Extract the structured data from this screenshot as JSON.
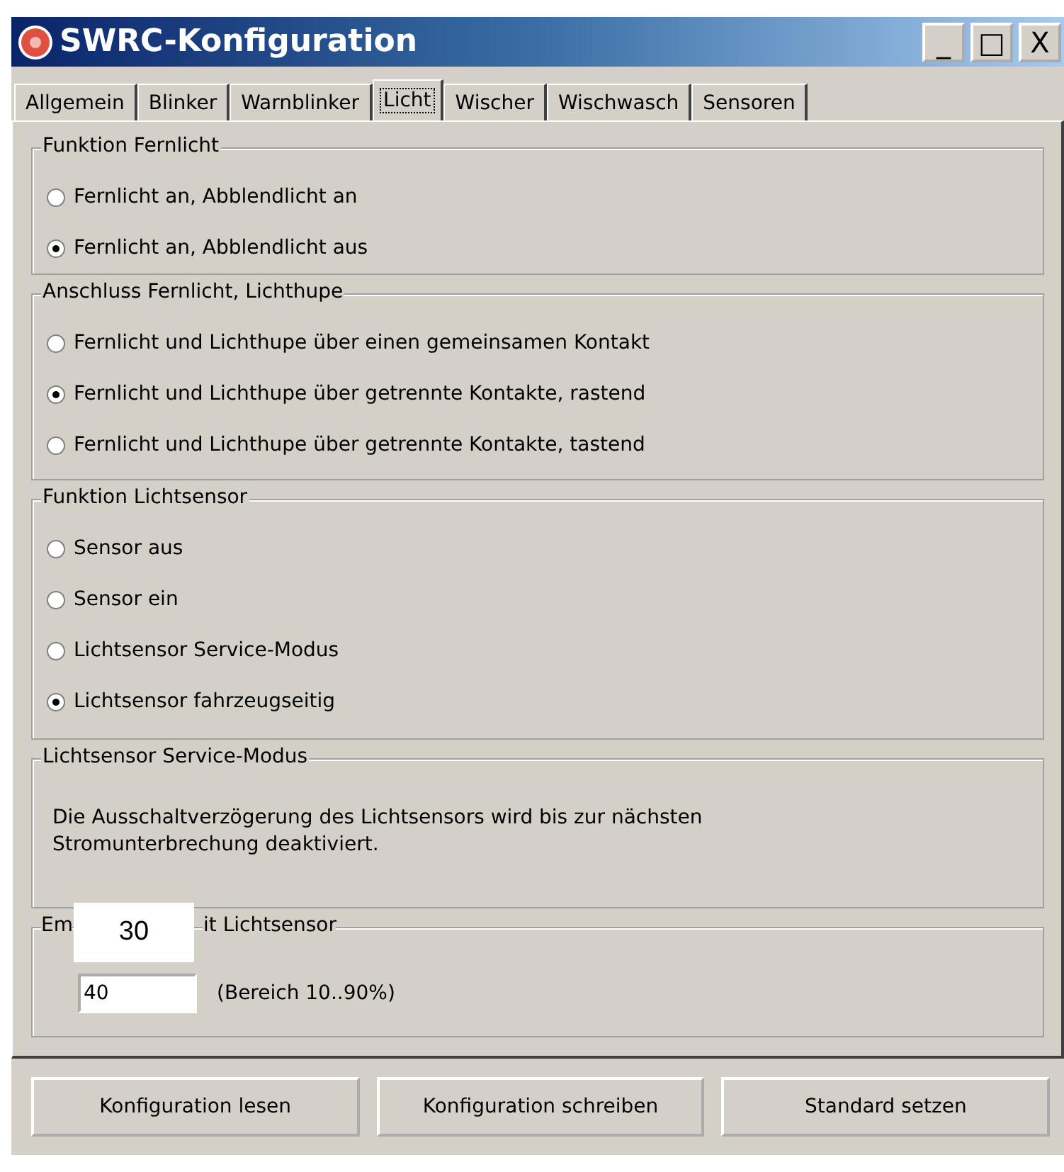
{
  "window": {
    "title": "SWRC-Konfiguration",
    "controls": [
      "_",
      "□",
      "X"
    ]
  },
  "tabs": [
    {
      "label": "Allgemein",
      "selected": false
    },
    {
      "label": "Blinker",
      "selected": false
    },
    {
      "label": "Warnblinker",
      "selected": false
    },
    {
      "label": "Licht",
      "selected": true
    },
    {
      "label": "Wischer",
      "selected": false
    },
    {
      "label": "Wischwasch",
      "selected": false
    },
    {
      "label": "Sensoren",
      "selected": false
    }
  ],
  "groups": [
    {
      "kind": "radios",
      "title": "Funktion Fernlicht",
      "options": [
        {
          "label": "Fernlicht an, Abblendlicht an",
          "selected": false
        },
        {
          "label": "Fernlicht an, Abblendlicht aus",
          "selected": true
        }
      ]
    },
    {
      "kind": "radios",
      "title": "Anschluss Fernlicht, Lichthupe",
      "options": [
        {
          "label": "Fernlicht und Lichthupe über einen gemeinsamen Kontakt",
          "selected": false
        },
        {
          "label": "Fernlicht und Lichthupe über getrennte Kontakte, rastend",
          "selected": true
        },
        {
          "label": "Fernlicht und Lichthupe über getrennte Kontakte, tastend",
          "selected": false
        }
      ]
    },
    {
      "kind": "radios",
      "title": "Funktion Lichtsensor",
      "options": [
        {
          "label": "Sensor aus",
          "selected": false
        },
        {
          "label": "Sensor ein",
          "selected": false
        },
        {
          "label": "Lichtsensor Service-Modus",
          "selected": false
        },
        {
          "label": "Lichtsensor fahrzeugseitig",
          "selected": true
        }
      ]
    },
    {
      "kind": "text",
      "title": "Lichtsensor Service-Modus",
      "text": "Die Ausschaltverzögerung des Lichtsensors wird bis zur nächsten Stromunterbrechung deaktiviert."
    },
    {
      "kind": "input",
      "title_start": "Em",
      "title_end": "it Lichtsensor",
      "value": "40",
      "hint": "(Bereich 10..90%)",
      "overlay": "30"
    }
  ],
  "buttons": [
    "Konfiguration lesen",
    "Konfiguration schreiben",
    "Standard setzen"
  ]
}
